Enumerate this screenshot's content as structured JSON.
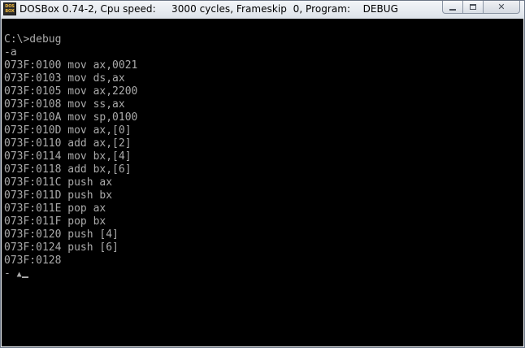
{
  "window": {
    "title": "DOSBox 0.74-2, Cpu speed:     3000 cycles, Frameskip  0, Program:    DEBUG",
    "icon_text": [
      "DOS",
      "BOX"
    ],
    "buttons": {
      "minimize_icon": "minimize-icon",
      "maximize_icon": "maximize-icon",
      "close_icon": "close-icon"
    }
  },
  "console": {
    "lines": [
      "C:\\>debug",
      "-a",
      "073F:0100 mov ax,0021",
      "073F:0103 mov ds,ax",
      "073F:0105 mov ax,2200",
      "073F:0108 mov ss,ax",
      "073F:010A mov sp,0100",
      "073F:010D mov ax,[0]",
      "073F:0110 add ax,[2]",
      "073F:0114 mov bx,[4]",
      "073F:0118 add bx,[6]",
      "073F:011C push ax",
      "073F:011D push bx",
      "073F:011E pop ax",
      "073F:011F pop bx",
      "073F:0120 push [4]",
      "073F:0124 push [6]",
      "073F:0128"
    ],
    "prompt": "- ",
    "mouse_symbol": "▲"
  }
}
